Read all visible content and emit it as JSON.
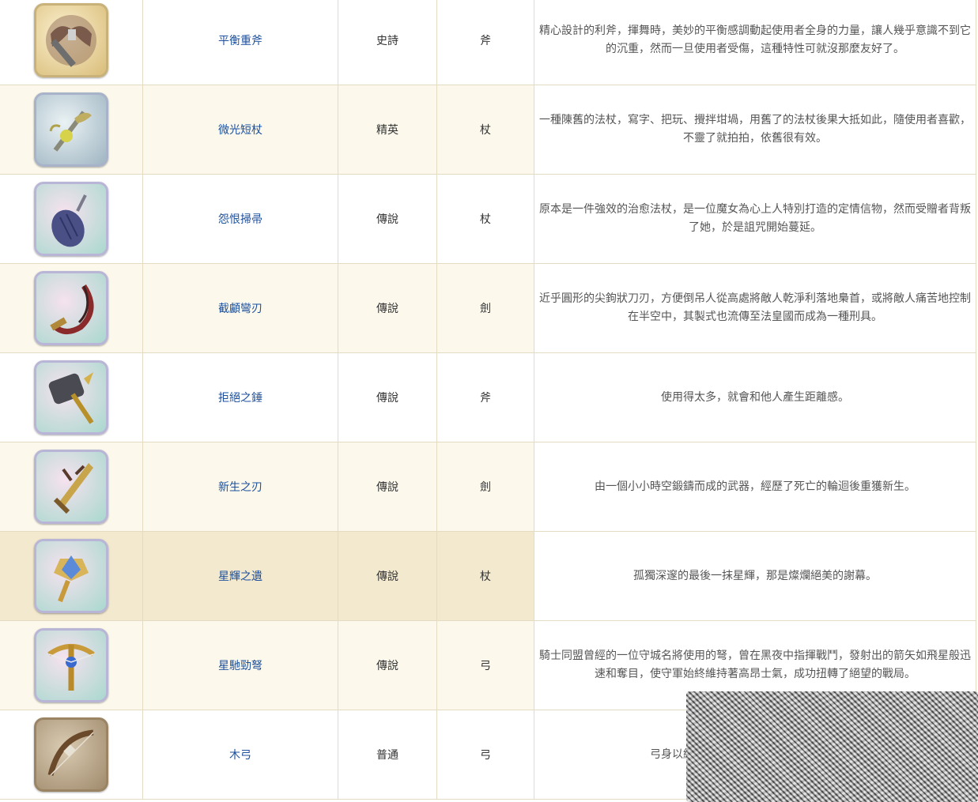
{
  "rows": [
    {
      "name": "平衡重斧",
      "rarity": "史詩",
      "type": "斧",
      "desc": "精心設計的利斧，揮舞時，美妙的平衡感調動起使用者全身的力量，讓人幾乎意識不到它的沉重，然而一旦使用者受傷，這種特性可就沒那麼友好了。",
      "icon": "balanced-axe-icon"
    },
    {
      "name": "微光短杖",
      "rarity": "精英",
      "type": "杖",
      "desc": "一種陳舊的法杖，寫字、把玩、攪拌坩堝，用舊了的法杖後果大抵如此，隨使用者喜歡，不靈了就拍拍，依舊很有效。",
      "icon": "shimmer-wand-icon"
    },
    {
      "name": "怨恨掃帚",
      "rarity": "傳說",
      "type": "杖",
      "desc": "原本是一件強效的治愈法杖，是一位魔女為心上人特別打造的定情信物，然而受贈者背叛了她，於是詛咒開始蔓延。",
      "icon": "grudge-broom-icon"
    },
    {
      "name": "截顱彎刃",
      "rarity": "傳說",
      "type": "劍",
      "desc": "近乎圓形的尖鉤狀刀刃，方便倒吊人從高處將敵人乾淨利落地梟首，或將敵人痛苦地控制在半空中，其製式也流傳至法皇國而成為一種刑具。",
      "icon": "skull-sickle-icon"
    },
    {
      "name": "拒絕之錘",
      "rarity": "傳說",
      "type": "斧",
      "desc": "使用得太多，就會和他人產生距離感。",
      "icon": "refusal-hammer-icon"
    },
    {
      "name": "新生之刃",
      "rarity": "傳說",
      "type": "劍",
      "desc": "由一個小小時空鍛鑄而成的武器，經歷了死亡的輪迴後重獲新生。",
      "icon": "rebirth-blade-icon"
    },
    {
      "name": "星輝之遺",
      "rarity": "傳說",
      "type": "杖",
      "desc": "孤獨深邃的最後一抹星輝，那是燦爛絕美的謝幕。",
      "icon": "starlight-relic-icon"
    },
    {
      "name": "星馳勁弩",
      "rarity": "傳說",
      "type": "弓",
      "desc": "騎士同盟曾經的一位守城名將使用的弩，曾在黑夜中指揮戰鬥，發射出的箭矢如飛星般迅速和奪目，使守軍始終維持著高昂士氣，成功扭轉了絕望的戰局。",
      "icon": "star-crossbow-icon"
    },
    {
      "name": "木弓",
      "rarity": "普通",
      "type": "弓",
      "desc": "弓身以結實的樹枝和棉線製成，比起精準度",
      "icon": "wooden-bow-icon"
    }
  ]
}
